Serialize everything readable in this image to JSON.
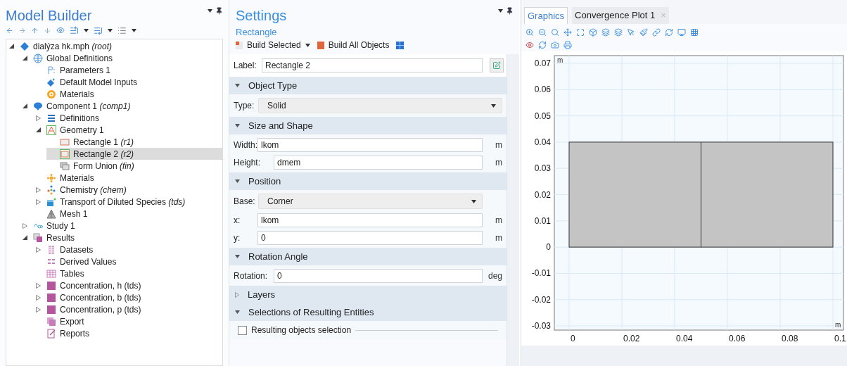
{
  "model_builder": {
    "title": "Model Builder",
    "tree": [
      {
        "label": "dialýza hk.mph *(root)*",
        "kind": "root",
        "expanded": true,
        "selected": false,
        "children": [
          {
            "label": "Global Definitions",
            "kind": "globe",
            "expanded": true,
            "selected": false,
            "children": [
              {
                "label": "Parameters 1",
                "kind": "params",
                "selected": false
              },
              {
                "label": "Default Model Inputs",
                "kind": "inputs",
                "selected": false
              },
              {
                "label": "Materials",
                "kind": "materials",
                "selected": false
              }
            ]
          },
          {
            "label": "Component 1 *(comp1)*",
            "kind": "component",
            "expanded": true,
            "selected": false,
            "children": [
              {
                "label": "Definitions",
                "kind": "definitions",
                "expanded": false,
                "selected": false
              },
              {
                "label": "Geometry 1",
                "kind": "geometry",
                "expanded": true,
                "selected": false,
                "children": [
                  {
                    "label": "Rectangle 1 *(r1)*",
                    "kind": "rect",
                    "selected": false
                  },
                  {
                    "label": "Rectangle 2 *(r2)*",
                    "kind": "rect2",
                    "selected": true
                  },
                  {
                    "label": "Form Union *(fin)*",
                    "kind": "union",
                    "selected": false
                  }
                ]
              },
              {
                "label": "Materials",
                "kind": "materials2",
                "selected": false
              },
              {
                "label": "Chemistry *(chem)*",
                "kind": "chemistry",
                "expanded": false,
                "selected": false
              },
              {
                "label": "Transport of Diluted Species *(tds)*",
                "kind": "transport",
                "expanded": false,
                "selected": false
              },
              {
                "label": "Mesh 1",
                "kind": "mesh",
                "selected": false
              }
            ]
          },
          {
            "label": "Study 1",
            "kind": "study",
            "expanded": false,
            "selected": false
          },
          {
            "label": "Results",
            "kind": "results",
            "expanded": true,
            "selected": false,
            "children": [
              {
                "label": "Datasets",
                "kind": "datasets",
                "expanded": false,
                "selected": false
              },
              {
                "label": "Derived Values",
                "kind": "derived",
                "selected": false
              },
              {
                "label": "Tables",
                "kind": "tables",
                "selected": false
              },
              {
                "label": "Concentration, h (tds)",
                "kind": "plot",
                "expanded": false,
                "selected": false
              },
              {
                "label": "Concentration, b (tds)",
                "kind": "plot",
                "expanded": false,
                "selected": false
              },
              {
                "label": "Concentration, p (tds)",
                "kind": "plot",
                "expanded": false,
                "selected": false
              },
              {
                "label": "Export",
                "kind": "export",
                "selected": false
              },
              {
                "label": "Reports",
                "kind": "reports",
                "selected": false
              }
            ]
          }
        ]
      }
    ]
  },
  "settings": {
    "title": "Settings",
    "subtitle": "Rectangle",
    "toolbar": [
      {
        "label": "Build Selected",
        "dropdown": true
      },
      {
        "label": "Build All Objects",
        "dropdown": false
      }
    ],
    "label_field": {
      "label": "Label:",
      "value": "Rectangle 2"
    },
    "sections": [
      {
        "title": "Object Type",
        "expanded": true,
        "rows": [
          {
            "kind": "select",
            "label": "Type:",
            "value": "Solid",
            "wide": true
          }
        ]
      },
      {
        "title": "Size and Shape",
        "expanded": true,
        "rows": [
          {
            "kind": "text",
            "label": "Width:",
            "value": "lkom",
            "unit": "m"
          },
          {
            "kind": "text",
            "label": "Height:",
            "value": "dmem",
            "unit": "m"
          }
        ]
      },
      {
        "title": "Position",
        "expanded": true,
        "rows": [
          {
            "kind": "select",
            "label": "Base:",
            "value": "Corner",
            "wide": false
          },
          {
            "kind": "text",
            "label": "x:",
            "value": "lkom",
            "unit": "m"
          },
          {
            "kind": "text",
            "label": "y:",
            "value": "0",
            "unit": "m"
          }
        ]
      },
      {
        "title": "Rotation Angle",
        "expanded": true,
        "rows": [
          {
            "kind": "text",
            "label": "Rotation:",
            "value": "0",
            "unit": "deg"
          }
        ]
      },
      {
        "title": "Layers",
        "expanded": false
      },
      {
        "title": "Selections of Resulting Entities",
        "expanded": true,
        "rows": [
          {
            "kind": "checkbox",
            "label": "Resulting objects selection",
            "checked": false
          }
        ]
      }
    ]
  },
  "graphics": {
    "tabs": [
      {
        "label": "Graphics",
        "selected": true
      },
      {
        "label": "Convergence Plot 1",
        "selected": false,
        "close": "×"
      }
    ],
    "x_unit": "m",
    "y_unit": "m",
    "x_ticks": [
      "0",
      "0.02",
      "0.04",
      "0.06",
      "0.08",
      "0.1"
    ],
    "y_ticks": [
      "0.07",
      "0.06",
      "0.05",
      "0.04",
      "0.03",
      "0.02",
      "0.01",
      "0",
      "-0.01",
      "-0.02",
      "-0.03"
    ]
  }
}
